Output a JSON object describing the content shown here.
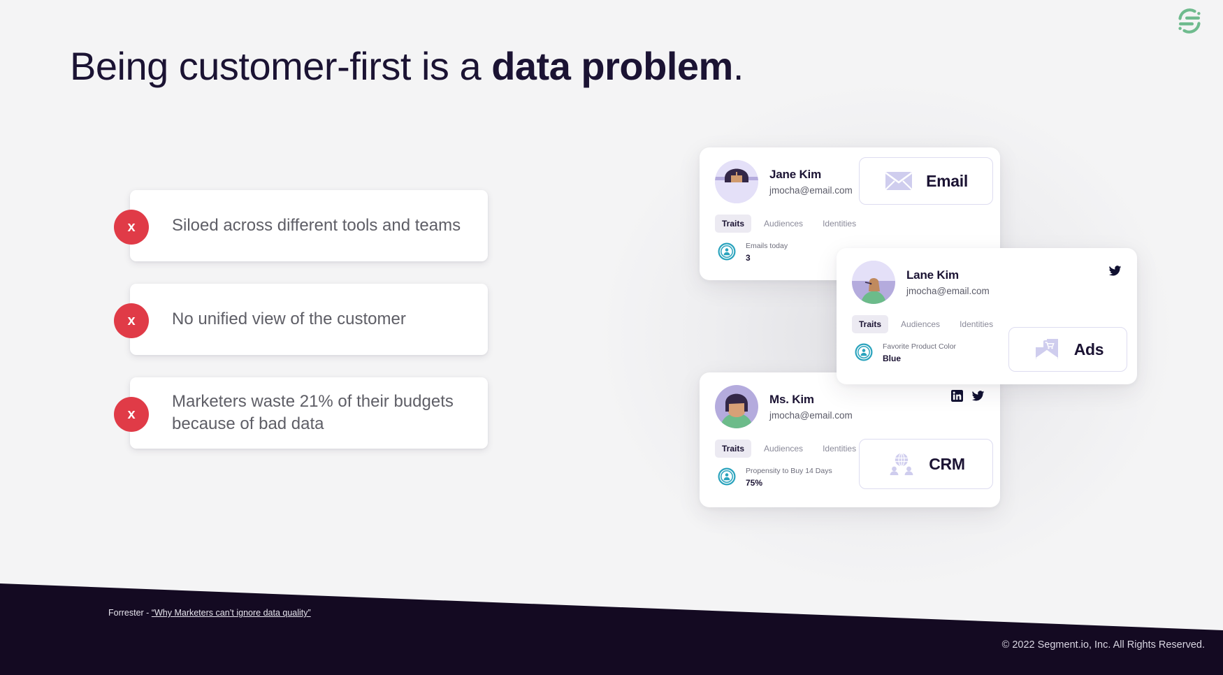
{
  "brand": {
    "logo_icon": "segment-logo-icon",
    "logo_color": "#6fbb8e",
    "accent_red": "#e03b47",
    "accent_teal": "#2aa3bd",
    "dark": "#140a22",
    "background": "#f4f4f5"
  },
  "headline": {
    "plain": "Being customer-first is a ",
    "bold": "data problem",
    "period": "."
  },
  "bullets": [
    {
      "marker": "x",
      "text": "Siloed across different tools and teams"
    },
    {
      "marker": "x",
      "text": "No unified view of the customer"
    },
    {
      "marker": "x",
      "text": "Marketers waste 21% of their budgets because of bad data"
    }
  ],
  "profile_cards": [
    {
      "id": "jane",
      "name": "Jane Kim",
      "email": "jmocha@email.com",
      "avatar_icon": "avatar-jane-icon",
      "socials": [],
      "tabs": [
        {
          "label": "Traits",
          "active": true
        },
        {
          "label": "Audiences",
          "active": false
        },
        {
          "label": "Identities",
          "active": false
        }
      ],
      "trait": {
        "icon": "user-circle-icon",
        "label": "Emails today",
        "value": "3"
      }
    },
    {
      "id": "lane",
      "name": "Lane Kim",
      "email": "jmocha@email.com",
      "avatar_icon": "avatar-lane-icon",
      "socials": [
        "twitter-icon"
      ],
      "tabs": [
        {
          "label": "Traits",
          "active": true
        },
        {
          "label": "Audiences",
          "active": false
        },
        {
          "label": "Identities",
          "active": false
        }
      ],
      "trait": {
        "icon": "user-circle-icon",
        "label": "Favorite Product Color",
        "value": "Blue"
      }
    },
    {
      "id": "mskim",
      "name": "Ms. Kim",
      "email": "jmocha@email.com",
      "avatar_icon": "avatar-mskim-icon",
      "socials": [
        "linkedin-icon",
        "twitter-icon"
      ],
      "tabs": [
        {
          "label": "Traits",
          "active": true
        },
        {
          "label": "Audiences",
          "active": false
        },
        {
          "label": "Identities",
          "active": false
        }
      ],
      "trait": {
        "icon": "user-circle-icon",
        "label": "Propensity to Buy 14 Days",
        "value": "75%"
      }
    }
  ],
  "channel_buttons": [
    {
      "id": "email",
      "label": "Email",
      "icon": "envelope-icon"
    },
    {
      "id": "ads",
      "label": "Ads",
      "icon": "ads-cart-icon"
    },
    {
      "id": "crm",
      "label": "CRM",
      "icon": "crm-globe-people-icon"
    }
  ],
  "footer": {
    "source_prefix": "Forrester - ",
    "source_link": "“Why Marketers can’t ignore data quality”",
    "copyright": "© 2022 Segment.io, Inc. All Rights Reserved."
  }
}
